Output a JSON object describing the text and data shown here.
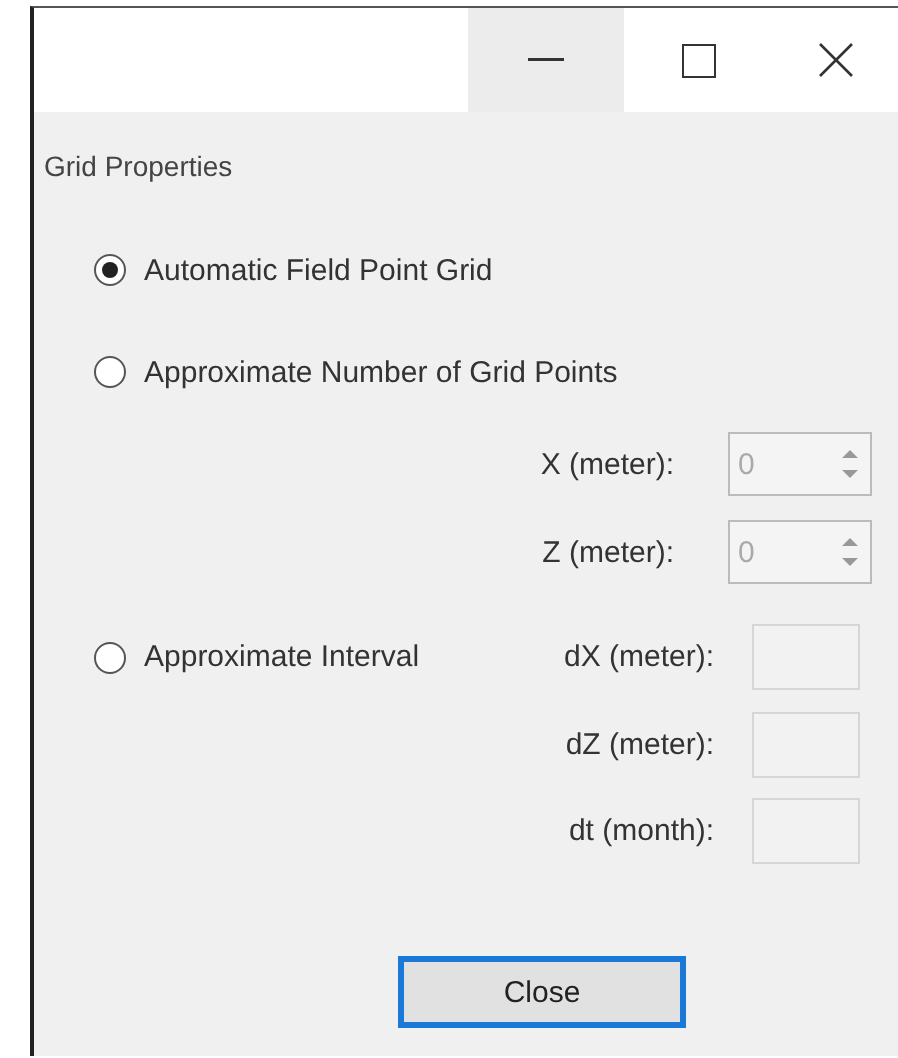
{
  "window": {
    "controls": [
      {
        "kind": "minimize",
        "hovered": true
      },
      {
        "kind": "maximize",
        "hovered": false
      },
      {
        "kind": "close",
        "hovered": false
      }
    ]
  },
  "group_title": "Grid Properties",
  "options": [
    {
      "label": "Automatic Field Point Grid",
      "selected": true
    },
    {
      "label": "Approximate Number of Grid Points",
      "selected": false
    },
    {
      "label": "Approximate Interval",
      "selected": false
    }
  ],
  "grid_points": [
    {
      "label": "X (meter):",
      "value": "0",
      "disabled": true
    },
    {
      "label": "Z (meter):",
      "value": "0",
      "disabled": true
    }
  ],
  "interval": [
    {
      "label": "dX (meter):",
      "disabled": true
    },
    {
      "label": "dZ (meter):",
      "disabled": true
    },
    {
      "label": "dt (month):",
      "disabled": true
    }
  ],
  "close_button": {
    "label": "Close",
    "focused": true
  }
}
